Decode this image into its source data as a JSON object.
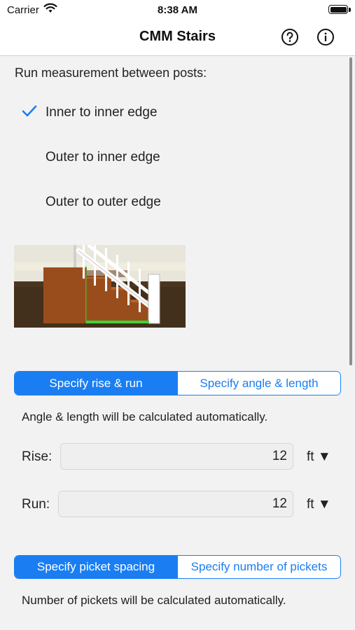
{
  "status_bar": {
    "carrier": "Carrier",
    "time": "8:38 AM"
  },
  "nav": {
    "title": "CMM Stairs",
    "help_icon": "question-circle-icon",
    "info_icon": "info-circle-icon"
  },
  "run_measurement": {
    "label": "Run measurement between posts:",
    "options": [
      {
        "label": "Inner to inner edge",
        "selected": true
      },
      {
        "label": "Outer to inner edge",
        "selected": false
      },
      {
        "label": "Outer to outer edge",
        "selected": false
      }
    ]
  },
  "rise_run_mode": {
    "segments": [
      "Specify rise & run",
      "Specify angle & length"
    ],
    "selected": 0,
    "hint": "Angle & length will be calculated automatically."
  },
  "rise": {
    "label": "Rise:",
    "value": "12",
    "unit": "ft ▼"
  },
  "run": {
    "label": "Run:",
    "value": "12",
    "unit": "ft ▼"
  },
  "picket_mode": {
    "segments": [
      "Specify picket spacing",
      "Specify number of pickets"
    ],
    "selected": 0,
    "hint": "Number of pickets will be calculated automatically."
  },
  "colors": {
    "accent": "#1a7ef2",
    "ground": "#4a3520",
    "stair_wood": "#8b4513",
    "measure_line": "#3bd43b"
  }
}
